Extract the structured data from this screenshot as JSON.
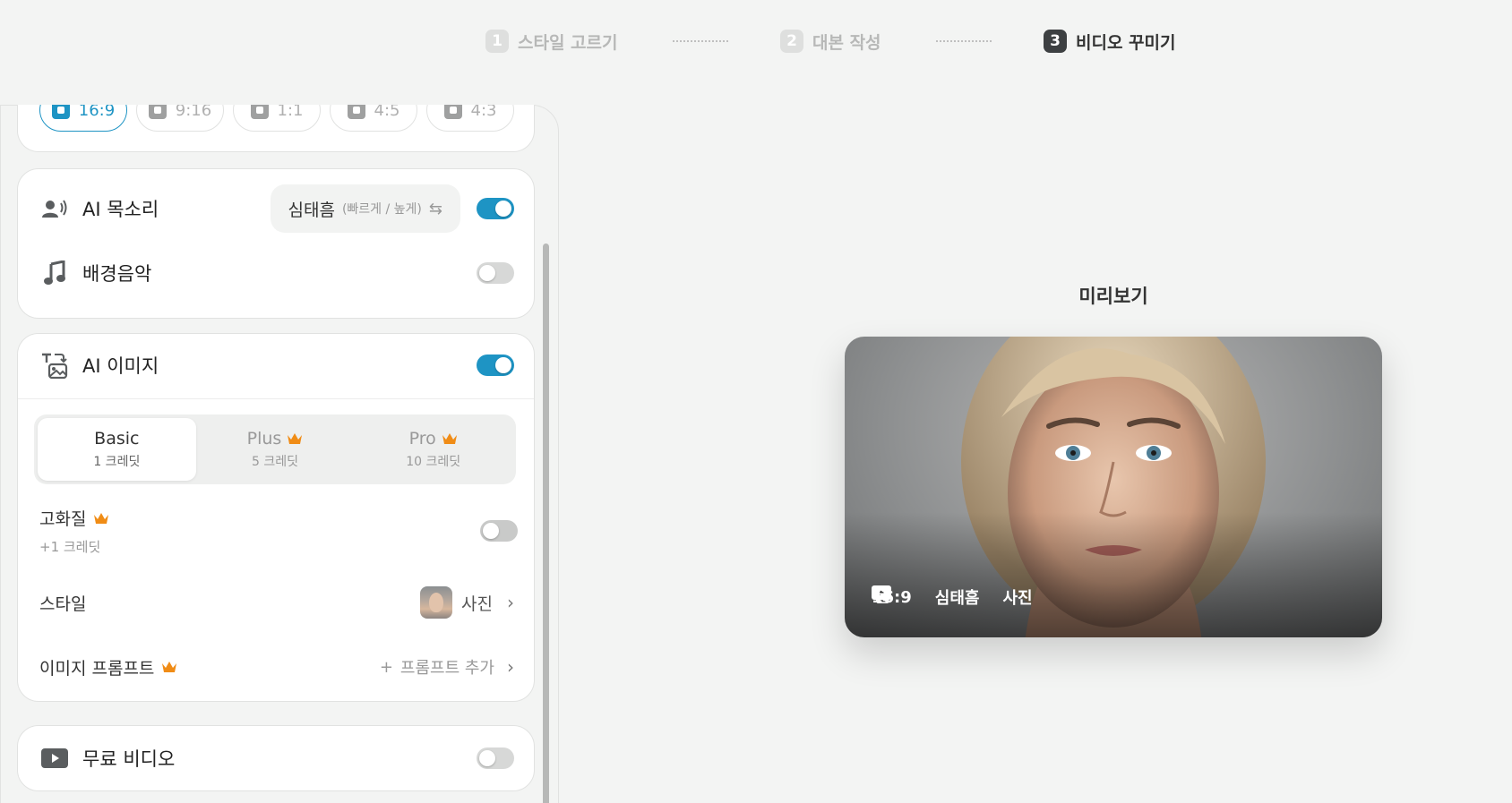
{
  "stepper": {
    "steps": [
      {
        "number": "1",
        "label": "스타일 고르기"
      },
      {
        "number": "2",
        "label": "대본 작성"
      },
      {
        "number": "3",
        "label": "비디오 꾸미기"
      }
    ]
  },
  "ratios": [
    {
      "label": "16:9",
      "selected": true
    },
    {
      "label": "9:16",
      "selected": false
    },
    {
      "label": "1:1",
      "selected": false
    },
    {
      "label": "4:5",
      "selected": false
    },
    {
      "label": "4:3",
      "selected": false
    }
  ],
  "audio": {
    "voice_title": "AI 목소리",
    "voice_name": "심태흠",
    "voice_desc": "(빠르게 / 높게)",
    "voice_enabled": true,
    "bgm_title": "배경음악",
    "bgm_enabled": false
  },
  "ai_image": {
    "title": "AI 이미지",
    "enabled": true,
    "tiers": [
      {
        "name": "Basic",
        "credit": "1 크레딧",
        "premium": false,
        "selected": true
      },
      {
        "name": "Plus",
        "credit": "5 크레딧",
        "premium": true,
        "selected": false
      },
      {
        "name": "Pro",
        "credit": "10 크레딧",
        "premium": true,
        "selected": false
      }
    ],
    "hq_label": "고화질",
    "hq_sub": "+1 크레딧",
    "hq_enabled": false,
    "style_label": "스타일",
    "style_value": "사진",
    "prompt_label": "이미지 프롬프트",
    "prompt_add": "프롬프트 추가"
  },
  "free_video": {
    "title": "무료 비디오",
    "enabled": false
  },
  "preview": {
    "title": "미리보기",
    "meta": {
      "ratio": "16:9",
      "voice": "심태흠",
      "style": "사진"
    }
  },
  "colors": {
    "accent": "#1e94c4",
    "crown": "#f08c16",
    "background": "#f3f4f3"
  }
}
